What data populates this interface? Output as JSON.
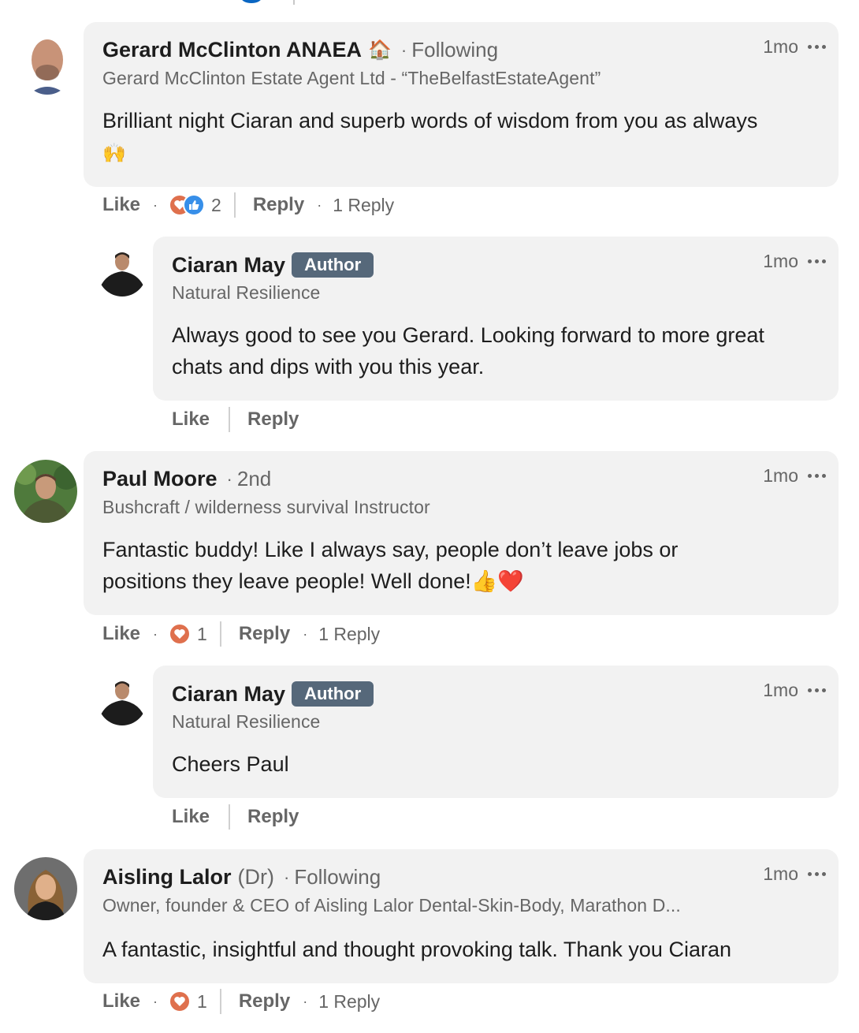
{
  "comments": [
    {
      "name": "Gerard McClinton ANAEA",
      "name_emoji": "🏠",
      "connection": "Following",
      "headline": "Gerard McClinton Estate Agent Ltd - “TheBelfastEstateAgent”",
      "time": "1mo",
      "text_line1": "Brilliant night Ciaran and superb words of wisdom from you as always",
      "text_line2": "🙌",
      "like_label": "Like",
      "reaction_count": "2",
      "reply_label": "Reply",
      "replies_label": "1 Reply",
      "reactions": [
        "love-icon",
        "like-icon"
      ]
    },
    {
      "name": "Ciaran May",
      "badge": "Author",
      "headline": "Natural Resilience",
      "time": "1mo",
      "text_line1": "Always good to see you Gerard. Looking forward to more great",
      "text_line2": "chats and dips with you this year.",
      "like_label": "Like",
      "reply_label": "Reply"
    },
    {
      "name": "Paul Moore",
      "connection": "2nd",
      "headline": "Bushcraft / wilderness survival Instructor",
      "time": "1mo",
      "text_line1": "Fantastic buddy! Like I always say, people don’t leave jobs or",
      "text_line2": "positions they leave people! Well done!👍❤️",
      "like_label": "Like",
      "reaction_count": "1",
      "reply_label": "Reply",
      "replies_label": "1 Reply",
      "reactions": [
        "love-icon"
      ]
    },
    {
      "name": "Ciaran May",
      "badge": "Author",
      "headline": "Natural Resilience",
      "time": "1mo",
      "text_line1": "Cheers Paul",
      "like_label": "Like",
      "reply_label": "Reply"
    },
    {
      "name": "Aisling Lalor",
      "name_suffix": "(Dr)",
      "connection": "Following",
      "headline": "Owner, founder & CEO of Aisling Lalor Dental-Skin-Body, Marathon D...",
      "time": "1mo",
      "text_line1": "A fantastic, insightful and thought provoking talk. Thank you Ciaran",
      "like_label": "Like",
      "reaction_count": "1",
      "reply_label": "Reply",
      "replies_label": "1 Reply",
      "reactions": [
        "love-icon"
      ]
    }
  ],
  "colors": {
    "bubble": "#f2f2f2",
    "badge": "#56687a",
    "love": "#df704d",
    "like": "#378fe9",
    "secondary_text": "#666666"
  }
}
